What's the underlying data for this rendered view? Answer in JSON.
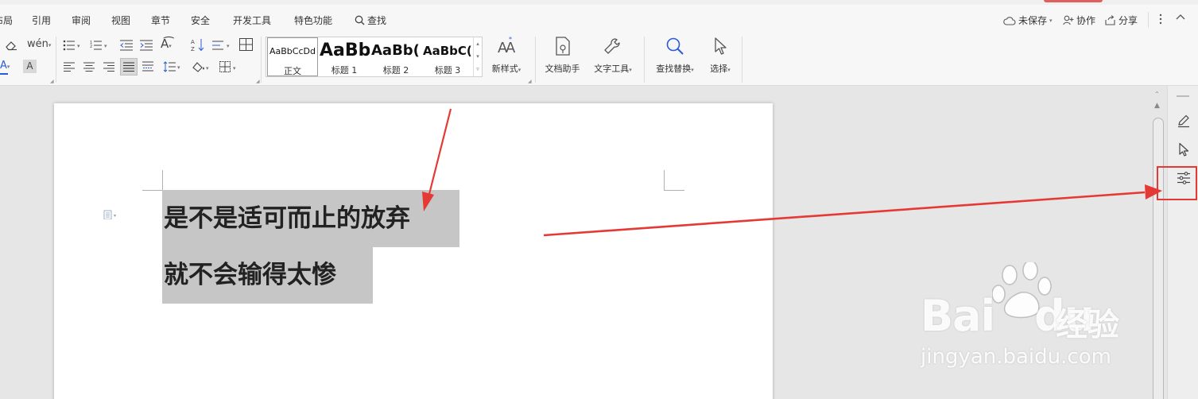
{
  "menu": {
    "tabs": [
      "布局",
      "引用",
      "审阅",
      "视图",
      "章节",
      "安全",
      "开发工具",
      "特色功能"
    ],
    "search_label": "查找",
    "unsaved_label": "未保存",
    "collaborate_label": "协作",
    "share_label": "分享",
    "more_icon": "more-vertical-icon",
    "collapse_icon": "chevron-up-icon"
  },
  "ribbon": {
    "styles": [
      {
        "sample": "AaBbCcDd",
        "name": "正文"
      },
      {
        "sample": "AaBb",
        "name": "标题 1"
      },
      {
        "sample": "AaBb(",
        "name": "标题 2"
      },
      {
        "sample": "AaBbC(",
        "name": "标题 3"
      }
    ],
    "new_style_label": "新样式",
    "doc_assistant_label": "文档助手",
    "text_tools_label": "文字工具",
    "find_replace_label": "查找替换",
    "select_label": "选择"
  },
  "document": {
    "line1": "是不是适可而止的放弃",
    "line2": "就不会输得太惨"
  },
  "watermark": {
    "brand": "Bai",
    "brand2": "du",
    "brand_cn": "经验",
    "url": "jingyan.baidu.com"
  },
  "taskpane": {
    "icons": [
      "edit-pen-icon",
      "cursor-arrow-icon",
      "settings-sliders-icon"
    ]
  },
  "colors": {
    "annotation_red": "#e53935",
    "selection_gray": "#c6c6c6"
  }
}
